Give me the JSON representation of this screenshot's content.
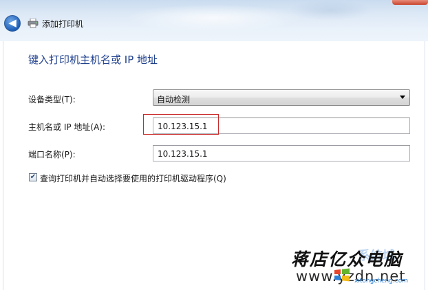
{
  "window": {
    "title": "添加打印机",
    "back_glyph": "◀"
  },
  "main": {
    "heading": "键入打印机主机名或 IP 地址",
    "device_type": {
      "label": "设备类型(T):",
      "value": "自动检测"
    },
    "hostname": {
      "label": "主机名或 IP 地址(A):",
      "value": "10.123.15.1"
    },
    "port": {
      "label": "端口名称(P):",
      "value": "10.123.15.1"
    },
    "query_checkbox": {
      "label": "查询打印机并自动选择要使用的打印机驱动程序(Q)",
      "checked": true,
      "check_glyph": "✔"
    }
  },
  "watermark": {
    "cn_text": "蒋店亿众电脑",
    "url": "www.yzdn.net",
    "sub": "xitongcheng.com",
    "faint": "系统城"
  },
  "colors": {
    "heading": "#1e3f8c",
    "highlight_border": "#c92a2a",
    "titlebar": "#dde9f6"
  }
}
